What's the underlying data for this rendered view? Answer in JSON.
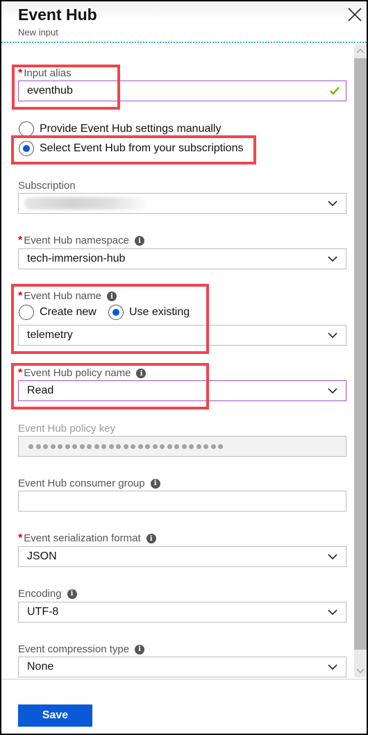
{
  "header": {
    "title": "Event Hub",
    "subtitle": "New input",
    "close_icon": "close-icon"
  },
  "colors": {
    "accent": "#0a5ad8",
    "focus_border": "#9e4fd1",
    "required": "#e00000",
    "valid_check": "#6bb700",
    "highlight_box": "#f0454f",
    "header_divider": "#2ab3e0"
  },
  "form": {
    "input_alias": {
      "label": "Input alias",
      "required": true,
      "value": "eventhub",
      "valid": true
    },
    "source_mode": {
      "options": [
        {
          "label": "Provide Event Hub settings manually",
          "selected": false
        },
        {
          "label": "Select Event Hub from your subscriptions",
          "selected": true
        }
      ]
    },
    "subscription": {
      "label": "Subscription",
      "value_redacted": true
    },
    "namespace": {
      "label": "Event Hub namespace",
      "required": true,
      "info": true,
      "value": "tech-immersion-hub"
    },
    "hub_name": {
      "label": "Event Hub name",
      "required": true,
      "info": true,
      "options": [
        {
          "label": "Create new",
          "selected": false
        },
        {
          "label": "Use existing",
          "selected": true
        }
      ],
      "value": "telemetry"
    },
    "policy_name": {
      "label": "Event Hub policy name",
      "required": true,
      "info": true,
      "value": "Read"
    },
    "policy_key": {
      "label": "Event Hub policy key",
      "disabled": true,
      "masked_length": 27
    },
    "consumer_group": {
      "label": "Event Hub consumer group",
      "info": true,
      "value": ""
    },
    "serialization": {
      "label": "Event serialization format",
      "required": true,
      "info": true,
      "value": "JSON"
    },
    "encoding": {
      "label": "Encoding",
      "info": true,
      "value": "UTF-8"
    },
    "compression": {
      "label": "Event compression type",
      "info": true,
      "value": "None"
    }
  },
  "footer": {
    "save_label": "Save"
  }
}
